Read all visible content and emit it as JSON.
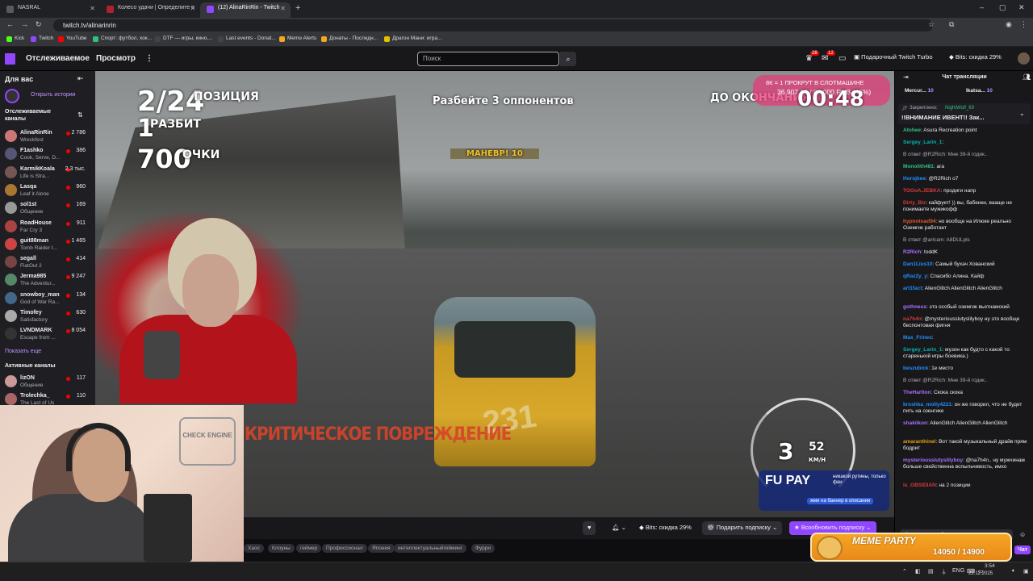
{
  "browser": {
    "tabs": [
      {
        "label": "NASRAL",
        "color": "#5a5a5a",
        "active": false
      },
      {
        "label": "Колесо удачи | Определите п",
        "color": "#b02030",
        "active": false
      },
      {
        "label": "(12) AlinaRinRin - Twitch",
        "color": "#9147ff",
        "active": true
      }
    ],
    "new_tab": "+",
    "url": "twitch.tv/alinarinrin",
    "bookmarks": [
      {
        "label": "Kick",
        "color": "#53fc18"
      },
      {
        "label": "Twitch",
        "color": "#9147ff"
      },
      {
        "label": "YouTube",
        "color": "#ff0000"
      },
      {
        "label": "Спорт: футбол, хок...",
        "color": "#2ec27e"
      },
      {
        "label": "DTF — игры, кино,...",
        "color": "#444"
      },
      {
        "label": "Last events - Donat...",
        "color": "#444"
      },
      {
        "label": "Meme Alerts",
        "color": "#f5a623"
      },
      {
        "label": "Донаты - Последн...",
        "color": "#f5a623"
      },
      {
        "label": "Драгон Мани: игра...",
        "color": "#e5c100"
      }
    ]
  },
  "twitch": {
    "nav": {
      "following": "Отслеживаемое",
      "browse": "Просмотр",
      "more": "⋮"
    },
    "search_placeholder": "Поиск",
    "notif_badges": [
      "28",
      "12"
    ],
    "turbo": "Подарочный Twitch Turbo",
    "bits": "Bits: скидка 29%",
    "accent": "#9147ff"
  },
  "sidebar": {
    "for_you": "Для вас",
    "open_stories": "Открыть истории",
    "followed_title": "Отслеживаемые каналы",
    "channels": [
      {
        "name": "AlinaRinRin",
        "game": "Wreckfest",
        "viewers": "2 786",
        "color": "#c77"
      },
      {
        "name": "F1ashko",
        "game": "Cook, Serve, D...",
        "viewers": "386",
        "color": "#557"
      },
      {
        "name": "KarmikKoala",
        "game": "Life is Stra...",
        "viewers": "2,3 тыс.",
        "color": "#755"
      },
      {
        "name": "Lasqa",
        "game": "Leaf it Alone",
        "viewers": "960",
        "color": "#a73"
      },
      {
        "name": "sol1st",
        "game": "Общение",
        "viewers": "169",
        "color": "#999"
      },
      {
        "name": "RoadHouse",
        "game": "Far Cry 3",
        "viewers": "911",
        "color": "#a44"
      },
      {
        "name": "guit88man",
        "game": "Tomb Raider I...",
        "viewers": "1 465",
        "color": "#c44"
      },
      {
        "name": "segall",
        "game": "FlatOut 2",
        "viewers": "414",
        "color": "#744"
      },
      {
        "name": "Jerma985",
        "game": "The Adventur...",
        "viewers": "9 247",
        "color": "#586"
      },
      {
        "name": "snowboy_man",
        "game": "God of War Ra...",
        "viewers": "134",
        "color": "#468"
      },
      {
        "name": "Timofey",
        "game": "Satisfactory",
        "viewers": "630",
        "color": "#aaa"
      },
      {
        "name": "LVNDMARK",
        "game": "Escape from ...",
        "viewers": "8 054",
        "color": "#333"
      }
    ],
    "show_more": "Показать еще",
    "active_title": "Активные каналы",
    "active_channels": [
      {
        "name": "lizON",
        "game": "Общение",
        "viewers": "117",
        "color": "#c99"
      },
      {
        "name": "Trolechka_",
        "game": "The Last of Us",
        "viewers": "110",
        "color": "#a66"
      }
    ]
  },
  "game_hud": {
    "position": "2/24",
    "position_label": "ПОЗИЦИЯ",
    "wrecked": "1",
    "wrecked_label": "РАЗБИТ",
    "points": "700",
    "points_label": "ОЧКИ",
    "objective": "Разбейте 3 оппонентов",
    "maneuver": "МАНЕВР! 10",
    "until_end": "ДО ОКОНЧАНИЯ",
    "timer": "00:48",
    "critical": "КРИТИЧЕСКОЕ ПОВРЕЖДЕНИЕ",
    "car_number": "231",
    "gear": "3",
    "speed": "52",
    "speed_unit": "КМ/Н",
    "donation_line1": "8К = 1 ПРОКРУТ В СЛОТМАШИНЕ",
    "donation_line2": "36 907.16 / 80 000 RUB (46%)",
    "donation_progress": 0.46,
    "fupay_brand": "FU PAY",
    "fupay_tagline": "никакой рутины, только фан",
    "fupay_cta": "жми на баннер в описании"
  },
  "player": {
    "bits_discount": "Bits: скидка 29%",
    "gift_sub": "Подарить подписку",
    "renew_sub": "Возобновить подписку",
    "tags": [
      "Хаос",
      "Клоуны",
      "геймер",
      "Профессионал",
      "Япония",
      "интеллектуальныйгейминг",
      "Фурри"
    ]
  },
  "chat": {
    "header": "Чат трансляции",
    "pinned_label": "Закреплено:",
    "pinned_by": "NightWolf_69",
    "pinned_text": "!!ВНИМАНИЕ ИВЕНТ!! Зак...",
    "leaderboard": [
      {
        "name": "Mercur...",
        "amount": "10"
      },
      {
        "name": "Ikatsa...",
        "amount": "10"
      }
    ],
    "messages": [
      {
        "user": "Atohee",
        "text": "Asura Recreation point",
        "color": "#2ec27e"
      },
      {
        "user": "Sergey_Larin_1",
        "text": "",
        "color": "#00b5ad"
      },
      {
        "user": "",
        "text": "В ответ @R2Rich: Мне 39-й годик..",
        "color": "#adadb8",
        "reply": true
      },
      {
        "user": "Monolith481",
        "text": "ага",
        "color": "#2ec27e"
      },
      {
        "user": "Horojkee",
        "text": "@R2Rich о7",
        "color": "#1e90ff"
      },
      {
        "user": "TOOoA.JEBKA",
        "text": "продиги напр",
        "color": "#d63a3a"
      },
      {
        "user": "Dirty_Biz",
        "text": "кайфует! )) вы, бабенки, вааще не понимаете мужикофф",
        "color": "#d63a3a"
      },
      {
        "user": "hypnotoad94",
        "text": "но вообще на Илюке реально Оземгик работает",
        "color": "#e05a2a"
      },
      {
        "user": "",
        "text": "В ответ @arlcam: A8DULpls",
        "color": "#adadb8",
        "reply": true
      },
      {
        "user": "R2Rich",
        "text": "toddK",
        "color": "#a970ff"
      },
      {
        "user": "Dan1Lius10",
        "text": "Самый бухач Хованский",
        "color": "#1e90ff"
      },
      {
        "user": "qRaz2y_y",
        "text": "Спасибо Алина. Кайф",
        "color": "#1e90ff"
      },
      {
        "user": "art1fact",
        "text": "AlienGlitch AlienGlitch AlienGlitch",
        "color": "#1e90ff"
      },
      {
        "user": "gothness",
        "text": "это особый оземгик вьетнамский",
        "color": "#a970ff"
      },
      {
        "user": "na7h4n",
        "text": "@mysteriousslutyslilyboy ну это вообще беспонтовая фигня",
        "color": "#d63a3a"
      },
      {
        "user": "Max_Frinex",
        "text": "",
        "color": "#1e90ff"
      },
      {
        "user": "Sergey_Larin_1",
        "text": "музон как будто с какой то старенькой игры боевика.)",
        "color": "#00b5ad"
      },
      {
        "user": "beszubick",
        "text": "1е место",
        "color": "#1e90ff"
      },
      {
        "user": "",
        "text": "В ответ @R2Rich: Мне 39-й годик..",
        "color": "#adadb8",
        "reply": true
      },
      {
        "user": "TheHarlton",
        "text": "Скока скока",
        "color": "#a970ff"
      },
      {
        "user": "kroshka_molly4221",
        "text": "он же говорил, что не будет пить на озенгике",
        "color": "#1e90ff"
      },
      {
        "user": "shakiikon",
        "text": "AlienGlitch AlienGlitch AlienGlitch",
        "color": "#a970ff"
      },
      {
        "user": "amaranthinel",
        "text": "Вот такой музыкальный драйв прям бодрит",
        "color": "#e5a10a"
      },
      {
        "user": "mysteriousslutyslilyboy",
        "text": "@na7h4n.. ну мужчинам больше свойственна вспыльчивость, имхо",
        "color": "#a970ff"
      },
      {
        "user": "is_OBSIDIAN",
        "text": "на 2 позиции",
        "color": "#d63a3a"
      }
    ],
    "input_placeholder": "Отправить сообщение",
    "chat_button": "Чат"
  },
  "meme_party": {
    "title": "MEME PARTY",
    "progress": "14050 / 14900",
    "colors": {
      "bg": "#f5a623",
      "border": "#ffe9b0"
    }
  },
  "webcam_sign": "CHECK ENGINE",
  "taskbar": {
    "lang": "ENG",
    "time": "3:54",
    "date": "22.12.2025"
  }
}
